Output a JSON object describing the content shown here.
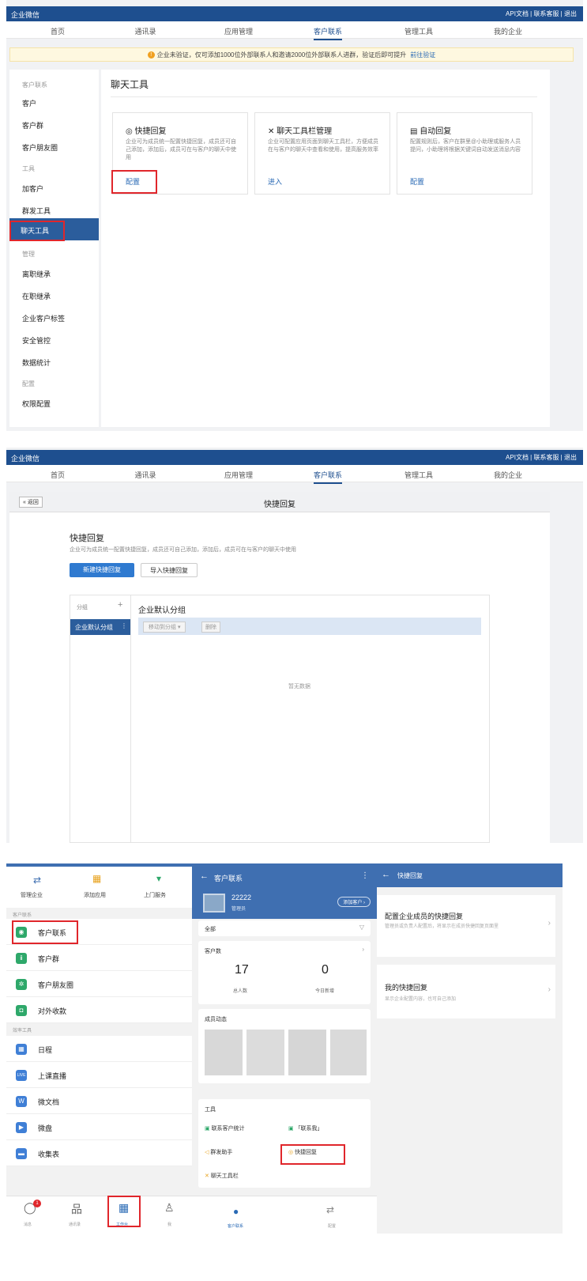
{
  "header": {
    "logo": "企业微信",
    "links": "API文档 | 联系客服 | 退出"
  },
  "nav": [
    "首页",
    "通讯录",
    "应用管理",
    "客户联系",
    "管理工具",
    "我的企业"
  ],
  "panel1": {
    "banner": {
      "text": "企业未验证，仅可添加1000位外部联系人和邀请2000位外部联系人进群，验证后即可提升",
      "link": "前往验证"
    },
    "sidebar": [
      "客户联系",
      "客户",
      "客户群",
      "客户朋友圈",
      "工具",
      "加客户",
      "群发工具",
      "聊天工具",
      "管理",
      "离职继承",
      "在职继承",
      "企业客户标签",
      "安全管控",
      "数据统计",
      "配置",
      "权限配置"
    ],
    "title": "聊天工具",
    "cards": [
      {
        "title": "快捷回复",
        "desc": "企业可为成员统一配置快捷回复，成员还可自己添加，添加后，成员可在与客户的聊天中使用",
        "action": "配置"
      },
      {
        "title": "聊天工具栏管理",
        "desc": "企业可配置应用页面到聊天工具栏，方便成员在与客户的聊天中查看和使用，提高服务效率",
        "action": "进入"
      },
      {
        "title": "自动回复",
        "desc": "配置规则后，客户在群里@小助理或服务人员提问，小助理将根据关键词自动发送消息内容",
        "action": "配置"
      }
    ]
  },
  "panel2": {
    "back": "« 返回",
    "bar_title": "快捷回复",
    "heading": "快捷回复",
    "desc": "企业可为成员统一配置快捷回复，成员还可自己添加，添加后，成员可在与客户的聊天中使用",
    "new_btn": "新建快捷回复",
    "import_btn": "导入快捷回复",
    "group_label": "分组",
    "plus": "+",
    "default_group": "企业默认分组",
    "group_title": "企业默认分组",
    "move_btn": "移动到分组 ▾",
    "delete_btn": "删除",
    "empty": "暂无数据"
  },
  "panel3": {
    "top_icons": [
      "管理企业",
      "添加应用",
      "上门服务"
    ],
    "sec1": "客户联系",
    "items1": [
      "客户联系",
      "客户群",
      "客户朋友圈",
      "对外收款"
    ],
    "sec2": "效率工具",
    "items2": [
      "日程",
      "上课直播",
      "微文档",
      "微盘",
      "收集表"
    ],
    "item_icon_text": [
      "LIVE",
      "W"
    ],
    "tabs": [
      "消息",
      "通讯录",
      "工作台",
      "我"
    ],
    "badge": "1"
  },
  "panel4": {
    "title": "客户联系",
    "org": "22222",
    "role": "管理员",
    "add_btn": "添加客户 ›",
    "filter": "全部",
    "count_title": "客户数",
    "total": "17",
    "total_label": "总人数",
    "today": "0",
    "today_label": "今日新增",
    "dynamics": "成员动态",
    "tools_title": "工具",
    "tools": [
      "联系客户统计",
      "「联系我」",
      "群发助手",
      "快捷回复",
      "聊天工具栏"
    ],
    "tabs": [
      "客户联系",
      "配置"
    ]
  },
  "panel5": {
    "title": "快捷回复",
    "items": [
      {
        "title": "配置企业成员的快捷回复",
        "desc": "管理员或负责人配置后，将显示在成员快捷回复页面里"
      },
      {
        "title": "我的快捷回复",
        "desc": "显示企业配置内容，也可自己添加"
      }
    ]
  },
  "colors": {
    "brand": "#1e4f8f",
    "accent": "#2f7ad0",
    "highlight": "#e0262b"
  }
}
